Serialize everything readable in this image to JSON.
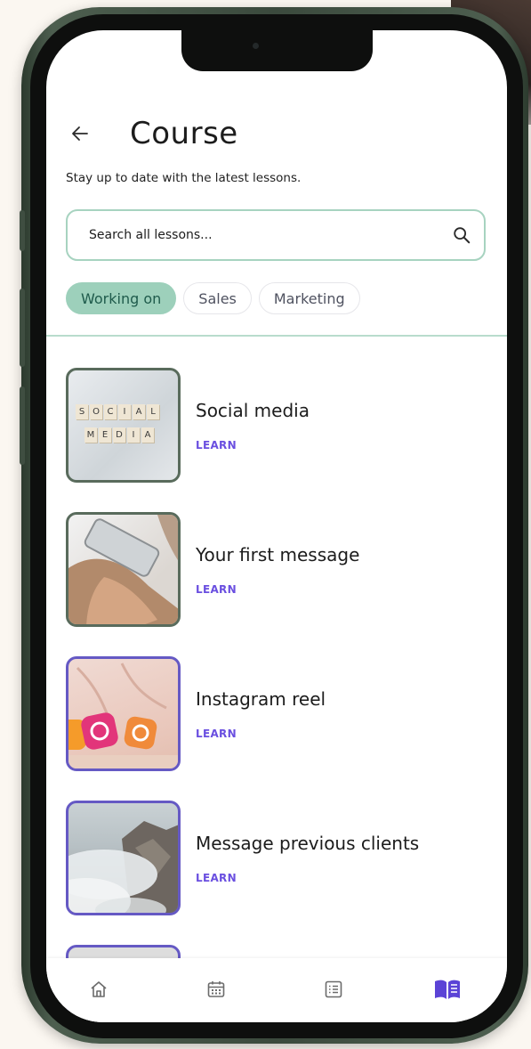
{
  "header": {
    "title": "Course",
    "subtitle": "Stay up to date with the latest lessons."
  },
  "search": {
    "placeholder": "Search all lessons..."
  },
  "filters": [
    {
      "label": "Working on",
      "active": true
    },
    {
      "label": "Sales",
      "active": false
    },
    {
      "label": "Marketing",
      "active": false
    }
  ],
  "lessons": [
    {
      "title": "Social media",
      "action": "LEARN",
      "thumbnail_tiles_row1": [
        "S",
        "O",
        "C",
        "I",
        "A",
        "L"
      ],
      "thumbnail_tiles_row2": [
        "M",
        "E",
        "D",
        "I",
        "A"
      ]
    },
    {
      "title": "Your first message",
      "action": "LEARN"
    },
    {
      "title": "Instagram reel",
      "action": "LEARN"
    },
    {
      "title": "Message previous clients",
      "action": "LEARN"
    }
  ],
  "tabbar": {
    "items": [
      {
        "icon": "home-icon",
        "active": false
      },
      {
        "icon": "calendar-icon",
        "active": false
      },
      {
        "icon": "list-icon",
        "active": false
      },
      {
        "icon": "book-icon",
        "active": true
      }
    ]
  },
  "colors": {
    "accent": "#6a4fe0",
    "chip_active": "#9dd0bb",
    "search_border": "#a7d3c0",
    "phone_frame": "#3b4a3d"
  }
}
